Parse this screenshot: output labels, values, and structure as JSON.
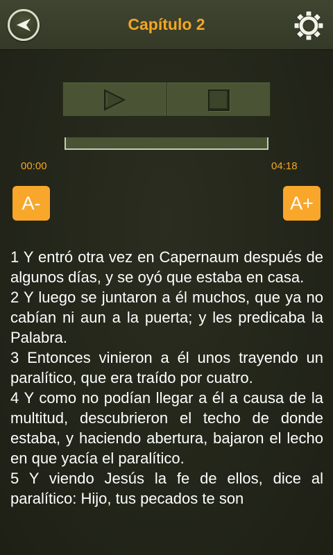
{
  "header": {
    "title": "Capítulo 2",
    "back_icon": "back-arrow-icon",
    "settings_icon": "gear-icon"
  },
  "player": {
    "play_icon": "play-icon",
    "stop_icon": "stop-icon",
    "time_elapsed": "00:00",
    "time_total": "04:18",
    "progress": 0
  },
  "font_controls": {
    "decrease_label": "A-",
    "increase_label": "A+"
  },
  "colors": {
    "accent": "#f4a623",
    "button_bg": "#f8a72b",
    "header_bg": "#3b412c",
    "page_bg": "#24261a",
    "text": "#ffffff"
  },
  "verses": [
    "1 Y entró otra vez en Capernaum después de algunos días, y se oyó que estaba en casa.",
    "2 Y luego se juntaron a él muchos, que ya no cabían ni aun a la puerta; y les predicaba la Palabra.",
    "3 Entonces vinieron a él unos trayendo un paralítico, que era traído por cuatro.",
    "4 Y como no podían llegar a él a causa de la multitud, descubrieron el techo de donde estaba, y haciendo abertura, bajaron el lecho en que yacía el paralítico.",
    "5 Y viendo Jesús la fe de ellos, dice al paralítico: Hijo, tus pecados te son"
  ]
}
